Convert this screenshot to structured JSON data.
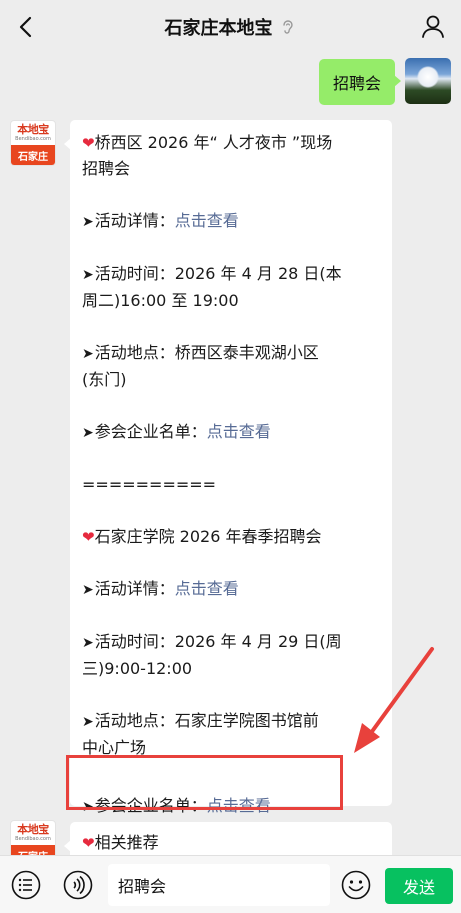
{
  "header": {
    "title": "石家庄本地宝"
  },
  "self_message": {
    "text": "招聘会"
  },
  "bot_logo": {
    "brand": "本地宝",
    "domain": "Bendibao.com",
    "city": "石家庄"
  },
  "message": {
    "event1": {
      "title_line1": "桥西区 2026 年“ 人才夜市 ”现场",
      "title_line2": "招聘会",
      "details_label": "活动详情：",
      "details_link": "点击查看",
      "time_line1": "活动时间：2026 年 4 月 28 日(本",
      "time_line2": "周二)16:00 至 19:00",
      "place_line1": "活动地点：桥西区泰丰观湖小区",
      "place_line2": "(东门)",
      "companies_label": "参会企业名单：",
      "companies_link": "点击查看"
    },
    "divider": "==========",
    "event2": {
      "title": "石家庄学院 2026 年春季招聘会",
      "details_label": "活动详情：",
      "details_link": "点击查看",
      "time_line1": "活动时间：2026 年 4 月 29 日(周",
      "time_line2": "三)9:00-12:00",
      "place_line1": "活动地点：石家庄学院图书馆前",
      "place_line2": "中心广场",
      "companies_label": "参会企业名单：",
      "companies_link": "点击查看"
    }
  },
  "second_message": {
    "text": "相关推荐"
  },
  "input_bar": {
    "text": "招聘会",
    "send_label": "发送"
  },
  "colors": {
    "link": "#576b95",
    "send": "#07c160",
    "self_bubble": "#95ec69",
    "annotation": "#e8413c"
  }
}
